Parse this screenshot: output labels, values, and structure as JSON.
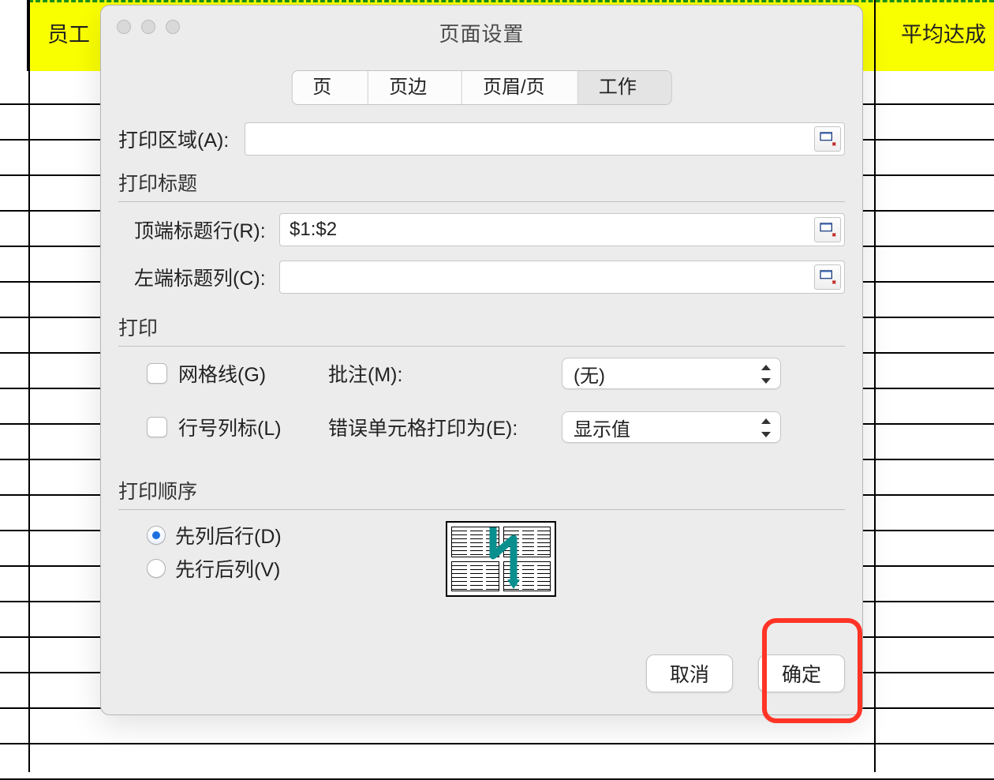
{
  "sheet": {
    "header_left": "员工",
    "header_right": "平均达成"
  },
  "dialog": {
    "title": "页面设置",
    "tabs": [
      "页面",
      "页边距",
      "页眉/页脚",
      "工作表"
    ],
    "active_tab": 3,
    "print_area": {
      "label": "打印区域(A):",
      "value": ""
    },
    "titles": {
      "section": "打印标题",
      "top_rows": {
        "label": "顶端标题行(R):",
        "value": "$1:$2"
      },
      "left_cols": {
        "label": "左端标题列(C):",
        "value": ""
      }
    },
    "print_opts": {
      "section": "打印",
      "gridlines": {
        "label": "网格线(G)",
        "checked": false
      },
      "headings": {
        "label": "行号列标(L)",
        "checked": false
      },
      "comments": {
        "label": "批注(M):",
        "value": "(无)"
      },
      "errors": {
        "label": "错误单元格打印为(E):",
        "value": "显示值"
      }
    },
    "order": {
      "section": "打印顺序",
      "down_then_over": {
        "label": "先列后行(D)",
        "checked": true
      },
      "over_then_down": {
        "label": "先行后列(V)",
        "checked": false
      }
    },
    "buttons": {
      "cancel": "取消",
      "ok": "确定"
    }
  }
}
